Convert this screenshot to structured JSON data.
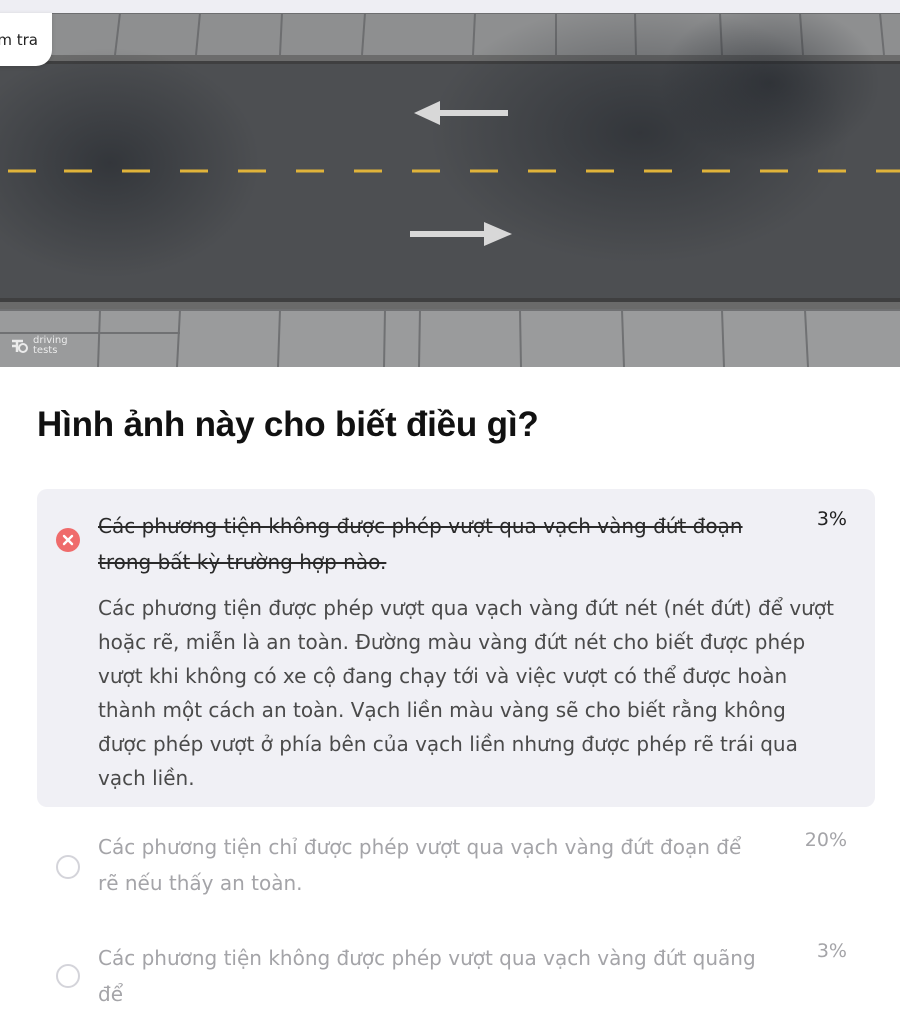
{
  "header": {
    "back_label": "m tra"
  },
  "image": {
    "description_icons": [
      "arrow-left-icon",
      "arrow-right-icon"
    ],
    "watermark_line1": "driving",
    "watermark_line2": "tests"
  },
  "question": {
    "title": "Hình ảnh này cho biết điều gì?"
  },
  "options": [
    {
      "text": "Các phương tiện không được phép vượt qua vạch vàng đứt đoạn trong bất kỳ trường hợp nào.",
      "percent": "3%",
      "state": "wrong-selected",
      "explanation": "Các phương tiện được phép vượt qua vạch vàng đứt nét (nét đứt) để vượt hoặc rẽ, miễn là an toàn. Đường màu vàng đứt nét cho biết được phép vượt khi không có xe cộ đang chạy tới và việc vượt có thể được hoàn thành một cách an toàn. Vạch liền màu vàng sẽ cho biết rằng không được phép vượt ở phía bên của vạch liền nhưng được phép rẽ trái qua vạch liền."
    },
    {
      "text": "Các phương tiện chỉ được phép vượt qua vạch vàng đứt đoạn để rẽ nếu thấy an toàn.",
      "percent": "20%",
      "state": "unselected"
    },
    {
      "text": "Các phương tiện không được phép vượt qua vạch vàng đứt quãng để",
      "percent": "3%",
      "state": "unselected"
    }
  ],
  "colors": {
    "wrong": "#ef6b6b",
    "selected_bg": "#f0f0f5",
    "muted_text": "#a4a4a8",
    "road_line": "#e0b33a"
  }
}
